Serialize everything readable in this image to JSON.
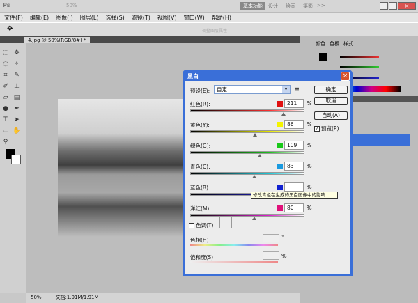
{
  "app": {
    "logo": "Ps",
    "zoom_select": "50%",
    "workspace": [
      "基本功能",
      "设计",
      "绘画",
      "摄影"
    ],
    "more": ">>"
  },
  "menu": [
    "文件(F)",
    "编辑(E)",
    "图像(I)",
    "图层(L)",
    "选择(S)",
    "滤镜(T)",
    "视图(V)",
    "窗口(W)",
    "帮助(H)"
  ],
  "options": {
    "hint": "调整图层属性"
  },
  "document": {
    "tab": "4.jpg @ 50%(RGB/8#) *",
    "zoom": "50%",
    "size": "文档:1.91M/1.91M"
  },
  "panels": {
    "tabs": [
      "颜色",
      "色板",
      "样式"
    ]
  },
  "dialog": {
    "title": "黑白",
    "preset_label": "预设(E):",
    "preset_value": "自定",
    "channels": [
      {
        "label": "红色(R):",
        "value": "211",
        "color": "#e01010",
        "pos": 0.82,
        "grad": "linear-gradient(90deg,#000,#ff3030 70%,#fff)"
      },
      {
        "label": "黄色(Y):",
        "value": "86",
        "color": "#f4f400",
        "pos": 0.57,
        "grad": "linear-gradient(90deg,#000,#e6e600 70%,#fff)"
      },
      {
        "label": "绿色(G):",
        "value": "109",
        "color": "#18c818",
        "pos": 0.61,
        "grad": "linear-gradient(90deg,#000,#20c020 70%,#fff)"
      },
      {
        "label": "青色(C):",
        "value": "83",
        "color": "#1a9ae0",
        "pos": 0.56,
        "grad": "linear-gradient(90deg,#000,#20c8d8 70%,#fff)"
      },
      {
        "label": "蓝色(B):",
        "value": "",
        "color": "#1020d0",
        "pos": 0.55,
        "grad": "linear-gradient(90deg,#000,#2020c0 70%,#fff)"
      },
      {
        "label": "洋红(M):",
        "value": "80",
        "color": "#e0107a",
        "pos": 0.56,
        "grad": "linear-gradient(90deg,#000,#e020d0 70%,#fff)"
      }
    ],
    "pct": "%",
    "tooltip": "修改青色在生成的黑白图像中的影响",
    "tint_label": "色调(T)",
    "hue_label": "色相(H)",
    "hue_unit": "°",
    "sat_label": "饱和度(S)",
    "sat_unit": "%",
    "buttons": {
      "ok": "确定",
      "cancel": "取消",
      "auto": "自动(A)"
    },
    "preview_label": "预览(P)",
    "preview_checked": true
  }
}
